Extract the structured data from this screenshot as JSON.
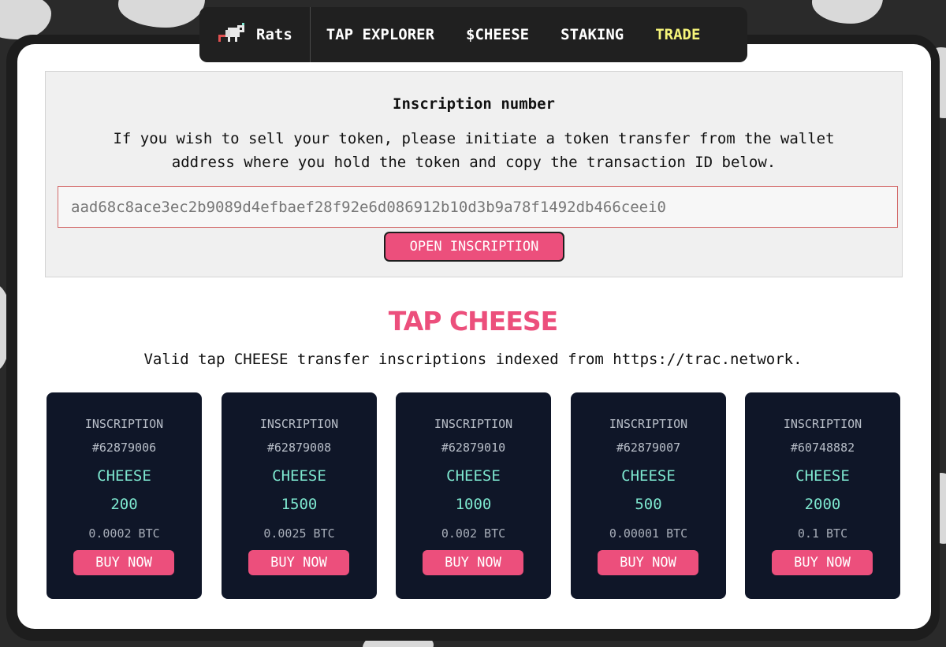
{
  "nav": {
    "brand": "Rats",
    "links": [
      "TAP EXPLORER",
      "$CHEESE",
      "STAKING",
      "TRADE"
    ]
  },
  "inscription": {
    "title": "Inscription number",
    "description": "If you wish to sell your token, please initiate a token transfer from the wallet address where you hold the token and copy the transaction ID below.",
    "input_value": "aad68c8ace3ec2b9089d4efbaef28f92e6d086912b10d3b9a78f1492db466ceei0",
    "open_button": "OPEN INSCRIPTION"
  },
  "tap": {
    "title": "TAP CHEESE",
    "subtitle": "Valid tap CHEESE transfer inscriptions indexed from https://trac.network."
  },
  "cards": [
    {
      "label": "INSCRIPTION",
      "number": "#62879006",
      "ticker": "CHEESE",
      "amount": "200",
      "price": "0.0002 BTC",
      "button": "BUY NOW"
    },
    {
      "label": "INSCRIPTION",
      "number": "#62879008",
      "ticker": "CHEESE",
      "amount": "1500",
      "price": "0.0025 BTC",
      "button": "BUY NOW"
    },
    {
      "label": "INSCRIPTION",
      "number": "#62879010",
      "ticker": "CHEESE",
      "amount": "1000",
      "price": "0.002 BTC",
      "button": "BUY NOW"
    },
    {
      "label": "INSCRIPTION",
      "number": "#62879007",
      "ticker": "CHEESE",
      "amount": "500",
      "price": "0.00001 BTC",
      "button": "BUY NOW"
    },
    {
      "label": "INSCRIPTION",
      "number": "#60748882",
      "ticker": "CHEESE",
      "amount": "2000",
      "price": "0.1 BTC",
      "button": "BUY NOW"
    }
  ],
  "colors": {
    "accent": "#ec4f7c",
    "trade_link": "#f6f57a",
    "card_bg": "#0f1628",
    "ticker": "#7ee8d0"
  },
  "icons": {
    "brand": "rat-pixel-icon"
  }
}
